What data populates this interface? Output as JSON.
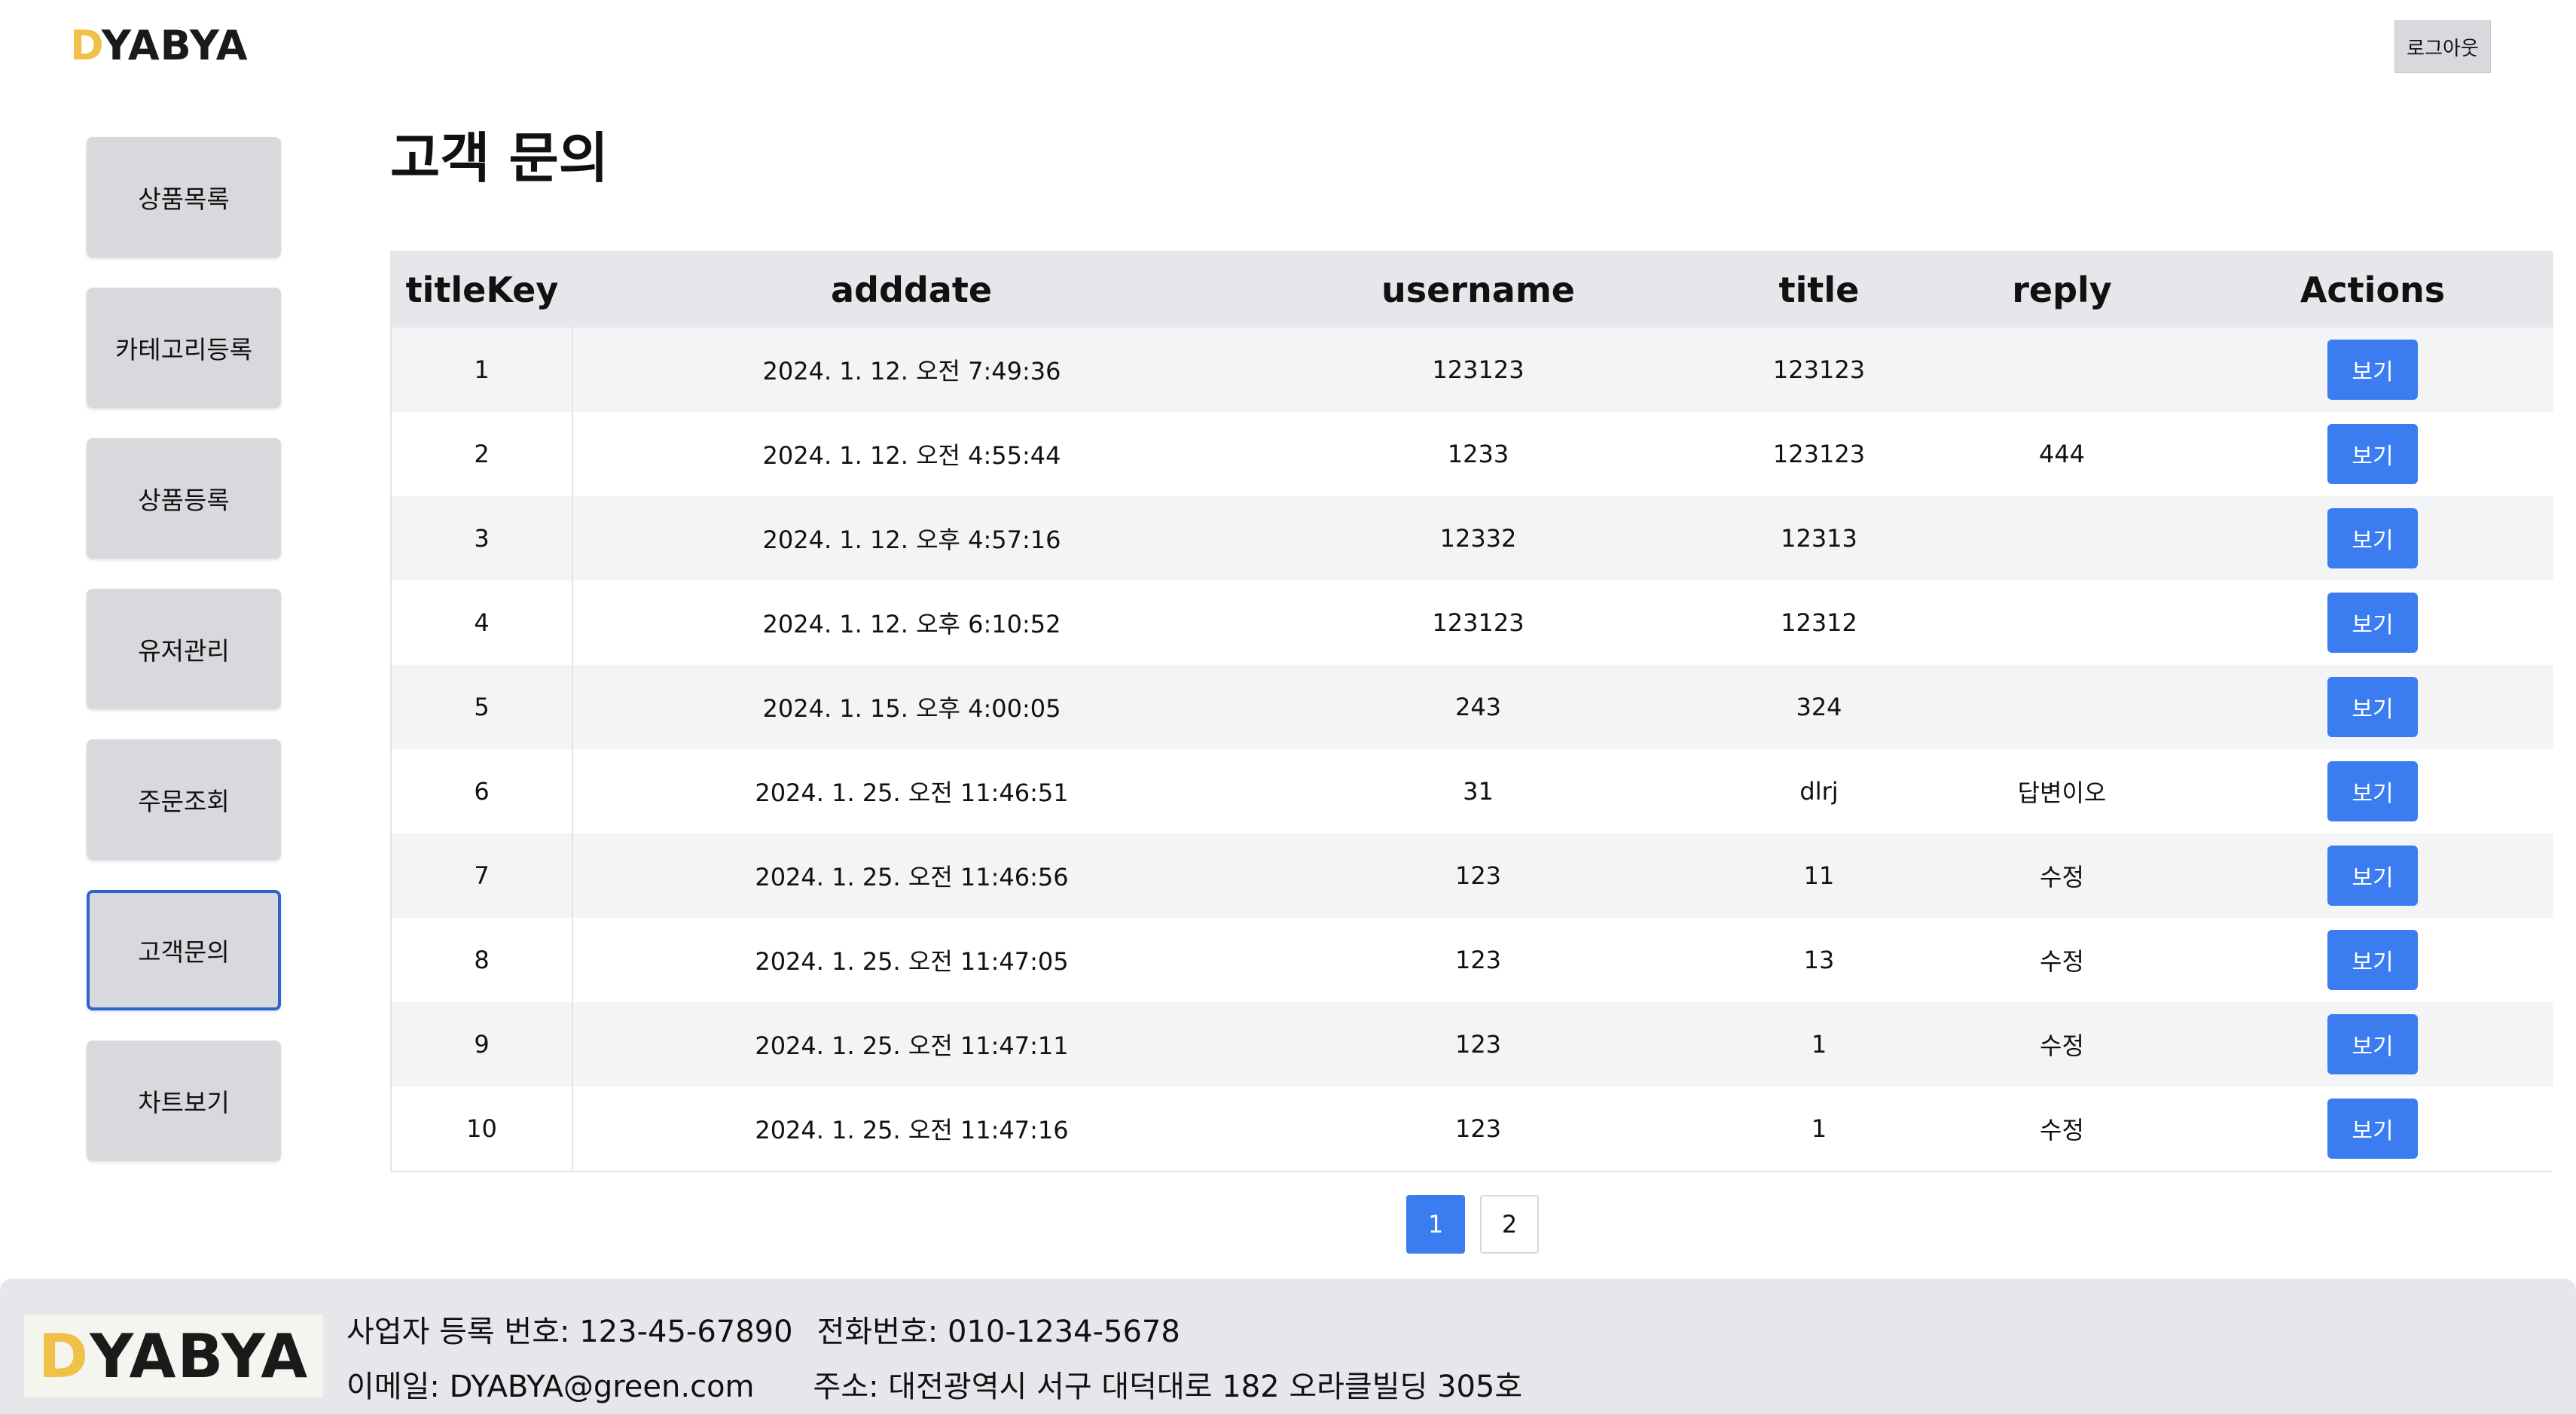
{
  "header": {
    "logo_first": "D",
    "logo_rest": "YABYA",
    "logout_label": "로그아웃"
  },
  "sidebar": {
    "items": [
      {
        "label": "상품목록"
      },
      {
        "label": "카테고리등록"
      },
      {
        "label": "상품등록"
      },
      {
        "label": "유저관리"
      },
      {
        "label": "주문조회"
      },
      {
        "label": "고객문의"
      },
      {
        "label": "차트보기"
      }
    ],
    "active_label": "고객문의"
  },
  "main": {
    "title": "고객 문의",
    "table": {
      "columns": [
        "titleKey",
        "adddate",
        "username",
        "title",
        "reply",
        "Actions"
      ],
      "rows": [
        {
          "titleKey": "1",
          "adddate": "2024. 1. 12. 오전 7:49:36",
          "username": "123123",
          "title": "123123",
          "reply": "",
          "action": "보기"
        },
        {
          "titleKey": "2",
          "adddate": "2024. 1. 12. 오전 4:55:44",
          "username": "1233",
          "title": "123123",
          "reply": "444",
          "action": "보기"
        },
        {
          "titleKey": "3",
          "adddate": "2024. 1. 12. 오후 4:57:16",
          "username": "12332",
          "title": "12313",
          "reply": "",
          "action": "보기"
        },
        {
          "titleKey": "4",
          "adddate": "2024. 1. 12. 오후 6:10:52",
          "username": "123123",
          "title": "12312",
          "reply": "",
          "action": "보기"
        },
        {
          "titleKey": "5",
          "adddate": "2024. 1. 15. 오후 4:00:05",
          "username": "243",
          "title": "324",
          "reply": "",
          "action": "보기"
        },
        {
          "titleKey": "6",
          "adddate": "2024. 1. 25. 오전 11:46:51",
          "username": "31",
          "title": "dlrj",
          "reply": "답변이오",
          "action": "보기"
        },
        {
          "titleKey": "7",
          "adddate": "2024. 1. 25. 오전 11:46:56",
          "username": "123",
          "title": "11",
          "reply": "수정",
          "action": "보기"
        },
        {
          "titleKey": "8",
          "adddate": "2024. 1. 25. 오전 11:47:05",
          "username": "123",
          "title": "13",
          "reply": "수정",
          "action": "보기"
        },
        {
          "titleKey": "9",
          "adddate": "2024. 1. 25. 오전 11:47:11",
          "username": "123",
          "title": "1",
          "reply": "수정",
          "action": "보기"
        },
        {
          "titleKey": "10",
          "adddate": "2024. 1. 25. 오전 11:47:16",
          "username": "123",
          "title": "1",
          "reply": "수정",
          "action": "보기"
        }
      ]
    },
    "pagination": {
      "pages": [
        "1",
        "2"
      ],
      "current": "1"
    }
  },
  "footer": {
    "logo_first": "D",
    "logo_rest": "YABYA",
    "business_number": "사업자 등록 번호: 123-45-67890",
    "phone": "전화번호: 010-1234-5678",
    "email": "이메일: DYABYA@green.com",
    "address": "주소: 대전광역시 서구 대덕대로 182 오라클빌딩 305호"
  },
  "colors": {
    "accent": "#3b7cf0",
    "logo_yellow": "#f0c048",
    "active_border": "#2f62d0"
  }
}
